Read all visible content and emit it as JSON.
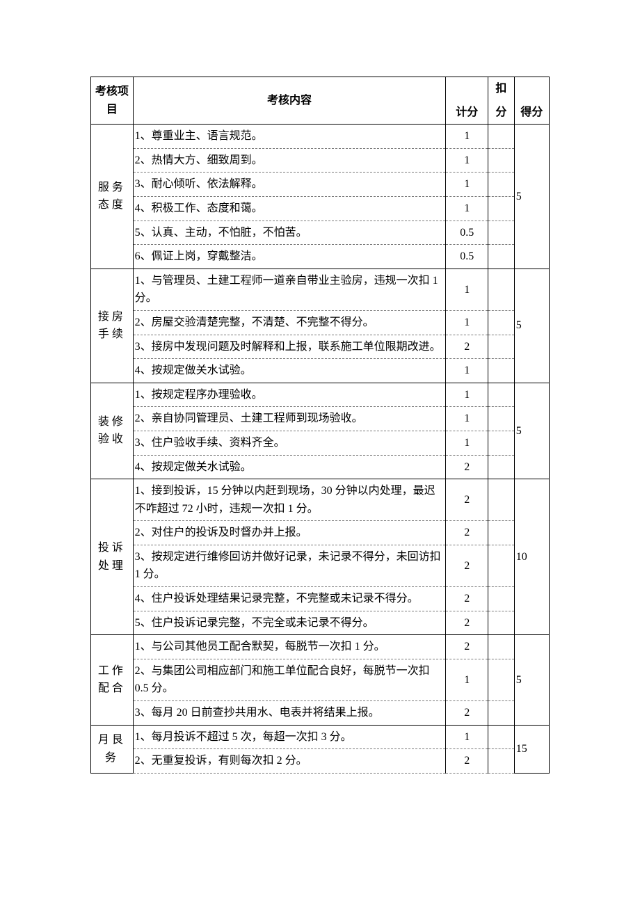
{
  "header": {
    "item": "考核项目",
    "content": "考核内容",
    "score": "计分",
    "deduct": "扣分",
    "total": "得分"
  },
  "groups": [
    {
      "name": "服务态度",
      "total": "5",
      "rows": [
        {
          "text": "1、尊重业主、语言规范。",
          "score": "1"
        },
        {
          "text": "2、热情大方、细致周到。",
          "score": "1"
        },
        {
          "text": "3、耐心倾听、依法解释。",
          "score": "1"
        },
        {
          "text": "4、积极工作、态度和蔼。",
          "score": "1"
        },
        {
          "text": "5、认真、主动，不怕脏，不怕苦。",
          "score": "0.5"
        },
        {
          "text": "6、佩证上岗，穿戴整洁。",
          "score": "0.5"
        }
      ]
    },
    {
      "name": "接房手续",
      "total": "5",
      "rows": [
        {
          "text": "1、与管理员、土建工程师一道亲自带业主验房，违规一次扣 1 分。",
          "score": "1"
        },
        {
          "text": "2、房屋交验清楚完整，不清楚、不完整不得分。",
          "score": "1"
        },
        {
          "text": "3、接房中发现问题及时解释和上报，联系施工单位限期改进。",
          "score": "2"
        },
        {
          "text": "4、按规定做关水试验。",
          "score": "1"
        }
      ]
    },
    {
      "name": "装修验收",
      "total": "5",
      "rows": [
        {
          "text": "1、按规定程序办理验收。",
          "score": "1"
        },
        {
          "text": "2、亲自协同管理员、土建工程师到现场验收。",
          "score": "1"
        },
        {
          "text": "3、住户验收手续、资料齐全。",
          "score": "1"
        },
        {
          "text": "4、按规定做关水试验。",
          "score": "2"
        }
      ]
    },
    {
      "name": "投诉处理",
      "total": "10",
      "rows": [
        {
          "text": "1、接到投诉，15 分钟以内赶到现场，30 分钟以内处理，最迟不咋超过 72 小时，违规一次扣 1 分。",
          "score": "2"
        },
        {
          "text": "2、对住户的投诉及时督办并上报。",
          "score": "2"
        },
        {
          "text": "3、按规定进行维修回访并做好记录，未记录不得分，未回访扣 1 分。",
          "score": "2"
        },
        {
          "text": "4、住户投诉处理结果记录完整，不完整或未记录不得分。",
          "score": "2"
        },
        {
          "text": "5、住户投诉记录完整，不完全或未记录不得分。",
          "score": "2"
        }
      ]
    },
    {
      "name": "工作配合",
      "total": "5",
      "rows": [
        {
          "text": "1、与公司其他员工配合默契，每脱节一次扣 1 分。",
          "score": "2"
        },
        {
          "text": "2、与集团公司相应部门和施工单位配合良好，每脱节一次扣 0.5 分。",
          "score": "1"
        },
        {
          "text": "3、每月 20 日前查抄共用水、电表并将结果上报。",
          "score": "2"
        }
      ]
    },
    {
      "name": "月艮务",
      "total": "15",
      "partial": true,
      "rows": [
        {
          "text": "1、每月投诉不超过 5 次，每超一次扣 3 分。",
          "score": "1"
        },
        {
          "text": "2、无重复投诉，有则每次扣 2 分。",
          "score": "2"
        }
      ]
    }
  ]
}
